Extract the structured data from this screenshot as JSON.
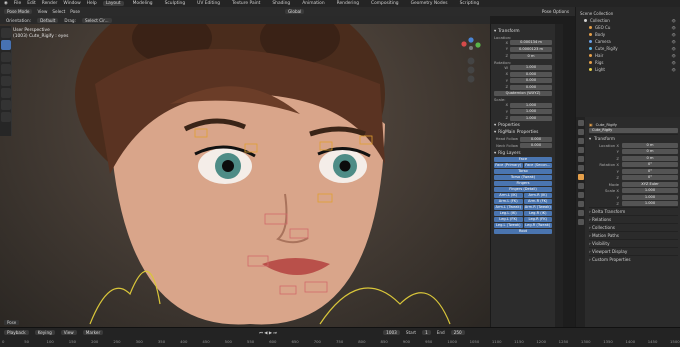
{
  "topbar": {
    "menus": [
      "File",
      "Edit",
      "Render",
      "Window",
      "Help"
    ],
    "workspaces": [
      "Layout",
      "Modeling",
      "Sculpting",
      "UV Editing",
      "Texture Paint",
      "Shading",
      "Animation",
      "Rendering",
      "Compositing",
      "Geometry Nodes",
      "Scripting"
    ],
    "active_workspace": "Layout"
  },
  "header": {
    "mode": "Pose Mode",
    "menus": [
      "View",
      "Select",
      "Pose"
    ],
    "global_label": "Global",
    "options_label": "Pose Options",
    "orientation_label": "Orientation:",
    "orientation_value": "Default",
    "drag_label": "Drag:",
    "drag_value": "Select Cir..."
  },
  "viewport": {
    "perspective": "User Perspective",
    "object": "(1003) Cute_Rigify : eyes"
  },
  "npanel": {
    "transform_title": "Transform",
    "location_title": "Location:",
    "location": [
      {
        "axis": "X",
        "value": "0.000134 m"
      },
      {
        "axis": "Y",
        "value": "0.0000123 m"
      },
      {
        "axis": "Z",
        "value": "0 m"
      }
    ],
    "rotation_title": "Rotation:",
    "rotation": [
      {
        "axis": "W",
        "value": "1.000"
      },
      {
        "axis": "X",
        "value": "0.000"
      },
      {
        "axis": "Y",
        "value": "0.000"
      },
      {
        "axis": "Z",
        "value": "0.000"
      }
    ],
    "rotation_mode": "Quaternion (WXYZ)",
    "scale_title": "Scale:",
    "scale": [
      {
        "axis": "X",
        "value": "1.000"
      },
      {
        "axis": "Y",
        "value": "1.000"
      },
      {
        "axis": "Z",
        "value": "1.000"
      }
    ],
    "properties_title": "Properties",
    "rigmain_title": "RigMain Properties",
    "rigmain_rows": [
      {
        "label": "Head Follow",
        "value": "0.000"
      },
      {
        "label": "Neck Follow",
        "value": "0.000"
      }
    ],
    "rig_layers_title": "Rig Layers",
    "rig_layers": [
      [
        "Face"
      ],
      [
        "Face (Primary)",
        "Face (Secon..."
      ],
      [
        "Torso"
      ],
      [
        "Torso (Tweak)"
      ],
      [
        "Fingers"
      ],
      [
        "Fingers (Detail)"
      ],
      [
        "Arm.L (IK)",
        "Arm.R (IK)"
      ],
      [
        "Arm.L (FK)",
        "Arm.R (FK)"
      ],
      [
        "Arm.L (Tweak)",
        "Arm.R (Tweak)"
      ],
      [
        "Leg.L (IK)",
        "Leg.R (IK)"
      ],
      [
        "Leg.L (FK)",
        "Leg.R (FK)"
      ],
      [
        "Leg.L (Tweak)",
        "Leg.R (Tweak)"
      ],
      [
        "Root"
      ]
    ]
  },
  "outliner": {
    "title": "Scene Collection",
    "items": [
      {
        "name": "Collection",
        "color": "#d0d0d0"
      },
      {
        "name": "GEO Cu",
        "color": "#e6a04a"
      },
      {
        "name": "Body",
        "color": "#e6a04a"
      },
      {
        "name": "Camera",
        "color": "#6aa0e6"
      },
      {
        "name": "Cute_Rigify",
        "color": "#5ab4e6"
      },
      {
        "name": "Hair",
        "color": "#e6a04a"
      },
      {
        "name": "Rigs",
        "color": "#e6a04a"
      },
      {
        "name": "Light",
        "color": "#e6d04a"
      }
    ]
  },
  "properties": {
    "object_name": "Cute_Rigify",
    "bone_name": "Cute_Rigify",
    "transform_title": "Transform",
    "location_label": "Location X",
    "location": [
      "0 m",
      "0 m",
      "0 m"
    ],
    "rotation_label": "Rotation X",
    "rotation": [
      "0°",
      "0°",
      "0°"
    ],
    "mode_label": "Mode",
    "mode_value": "XYZ Euler",
    "scale_label": "Scale X",
    "scale": [
      "1.000",
      "1.000",
      "1.000"
    ],
    "sections": [
      "Delta Transform",
      "Relations",
      "Collections",
      "Motion Paths",
      "Visibility",
      "Viewport Display",
      "Custom Properties"
    ]
  },
  "timeline": {
    "controls": [
      "Playback",
      "Keying",
      "View",
      "Marker"
    ],
    "current_frame": "1003",
    "start_label": "Start",
    "start_value": "1",
    "end_label": "End",
    "end_value": "250",
    "ticks": [
      "0",
      "50",
      "100",
      "150",
      "200",
      "250",
      "300",
      "350",
      "400",
      "450",
      "500",
      "550",
      "600",
      "650",
      "700",
      "750",
      "800",
      "850",
      "900",
      "950",
      "1000",
      "1050",
      "1100",
      "1150",
      "1200",
      "1250",
      "1300",
      "1350",
      "1400",
      "1450",
      "1500"
    ]
  },
  "frame_popup": "Pose"
}
